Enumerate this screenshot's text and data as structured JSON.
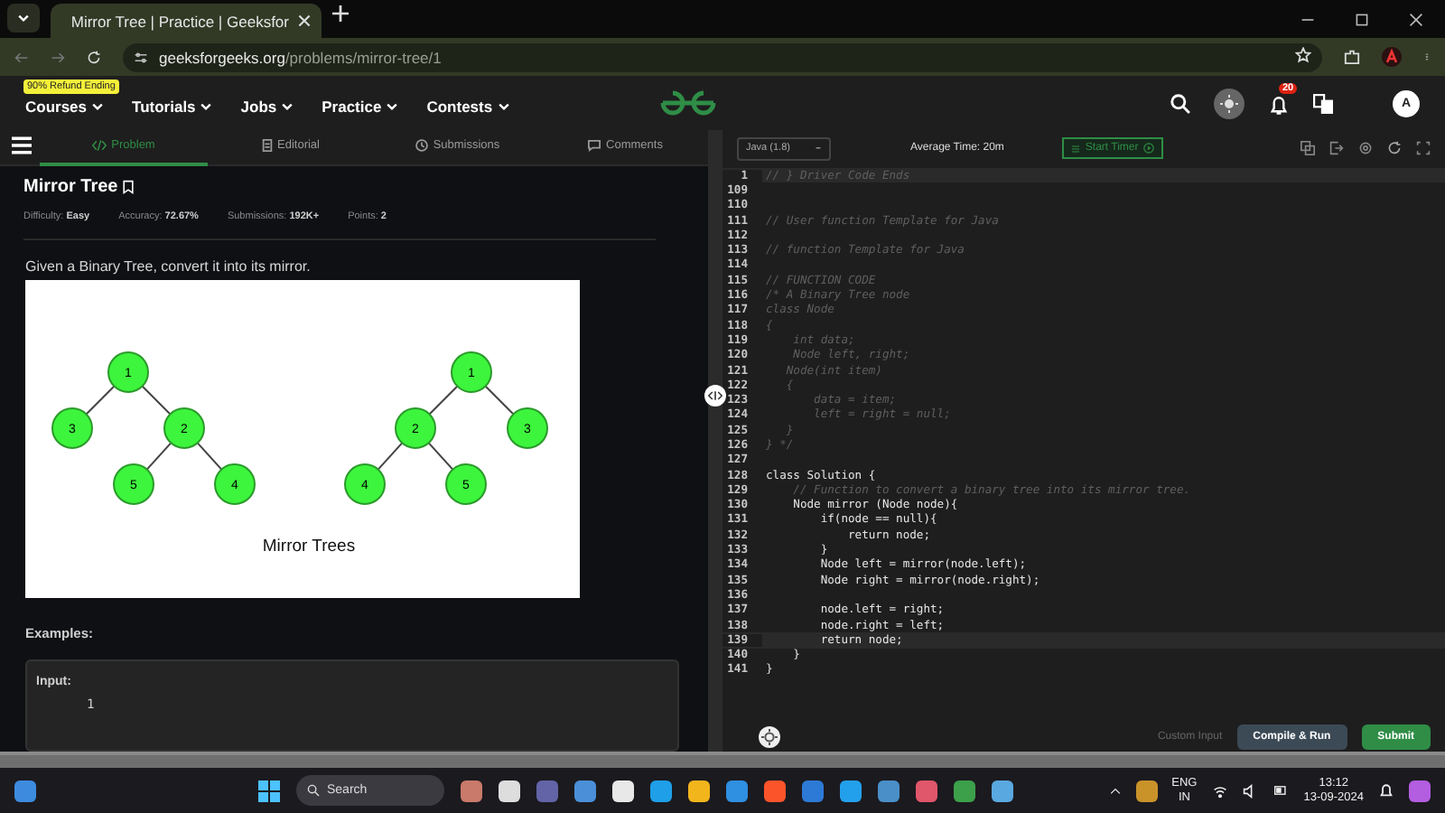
{
  "browser": {
    "tab_title": "Mirror Tree | Practice | Geeksfor",
    "url_domain": "geeksforgeeks.org",
    "url_path": "/problems/mirror-tree/1"
  },
  "site_nav": {
    "promo_badge": "90% Refund Ending",
    "items": [
      "Courses",
      "Tutorials",
      "Jobs",
      "Practice",
      "Contests"
    ],
    "notification_count": "20",
    "avatar_letter": "A"
  },
  "problem_tabs": [
    {
      "label": "Problem",
      "selected": true,
      "kind": "code"
    },
    {
      "label": "Editorial",
      "selected": false,
      "kind": "doc"
    },
    {
      "label": "Submissions",
      "selected": false,
      "kind": "clock"
    },
    {
      "label": "Comments",
      "selected": false,
      "kind": "chat"
    }
  ],
  "problem": {
    "title": "Mirror Tree",
    "meta": [
      "Difficulty: **Easy**",
      "Accuracy: **72.67%**",
      "Submissions: **192K+**",
      "Points: **2**"
    ],
    "description": "Given a Binary Tree, convert it into its mirror.",
    "figure": {
      "caption": "Mirror Trees",
      "trees": [
        {
          "label": "1",
          "children": [
            {
              "label": "3"
            },
            {
              "label": "2",
              "children": [
                {
                  "label": "5"
                },
                {
                  "label": "4"
                }
              ]
            }
          ]
        },
        {
          "label": "1",
          "children": [
            {
              "label": "2",
              "children": [
                {
                  "label": "4"
                },
                {
                  "label": "5"
                }
              ]
            },
            {
              "label": "3"
            }
          ]
        }
      ]
    },
    "examples_heading": "Examples:",
    "example_input_label": "Input:",
    "example_input_lines": [
      "1"
    ]
  },
  "editor": {
    "language": "Java (1.8)",
    "average_time": "Average Time: 20m",
    "timer_button": "Start Timer",
    "lines": [
      {
        "num": "1",
        "text": "// } Driver Code Ends",
        "kind": "comment",
        "highlighted": true
      },
      {
        "num": "109",
        "kind": "blank",
        "highlighted": false
      },
      {
        "num": "110",
        "kind": "blank",
        "highlighted": false
      },
      {
        "num": "111",
        "text": "// User function Template for Java",
        "kind": "comment",
        "highlighted": false
      },
      {
        "num": "112",
        "kind": "blank",
        "highlighted": false
      },
      {
        "num": "113",
        "text": "// function Template for Java",
        "kind": "comment",
        "highlighted": false
      },
      {
        "num": "114",
        "kind": "blank",
        "highlighted": false
      },
      {
        "num": "115",
        "text": "// FUNCTION CODE",
        "kind": "comment",
        "highlighted": false
      },
      {
        "num": "116",
        "text": "/* A Binary Tree node",
        "kind": "comment",
        "highlighted": false
      },
      {
        "num": "117",
        "text": "class Node",
        "kind": "comment",
        "highlighted": false
      },
      {
        "num": "118",
        "text": "{",
        "kind": "comment",
        "highlighted": false
      },
      {
        "num": "119",
        "text": "    int data;",
        "kind": "comment",
        "highlighted": false
      },
      {
        "num": "120",
        "text": "    Node left, right;",
        "kind": "comment",
        "highlighted": false
      },
      {
        "num": "121",
        "text": "   Node(int item)",
        "kind": "comment",
        "highlighted": false
      },
      {
        "num": "122",
        "text": "   {",
        "kind": "comment",
        "highlighted": false
      },
      {
        "num": "123",
        "text": "       data = item;",
        "kind": "comment",
        "highlighted": false
      },
      {
        "num": "124",
        "text": "       left = right = null;",
        "kind": "comment",
        "highlighted": false
      },
      {
        "num": "125",
        "text": "   }",
        "kind": "comment",
        "highlighted": false
      },
      {
        "num": "126",
        "text": "} */",
        "kind": "comment",
        "highlighted": false
      },
      {
        "num": "127",
        "kind": "blank",
        "highlighted": false
      },
      {
        "num": "128",
        "text": "class Solution {",
        "kind": "code",
        "highlighted": false
      },
      {
        "num": "129",
        "text": "    // Function to convert a binary tree into its mirror tree.",
        "kind": "comment",
        "highlighted": false
      },
      {
        "num": "130",
        "text": "    Node mirror (Node node){",
        "kind": "code",
        "highlighted": false
      },
      {
        "num": "131",
        "text": "        if(node == null){",
        "kind": "code",
        "highlighted": false
      },
      {
        "num": "132",
        "text": "            return node;",
        "kind": "code",
        "highlighted": false
      },
      {
        "num": "133",
        "text": "        }",
        "kind": "code",
        "highlighted": false
      },
      {
        "num": "134",
        "text": "        Node left = mirror(node.left);",
        "kind": "code",
        "highlighted": false
      },
      {
        "num": "135",
        "text": "        Node right = mirror(node.right);",
        "kind": "code",
        "highlighted": false
      },
      {
        "num": "136",
        "kind": "blank",
        "highlighted": false
      },
      {
        "num": "137",
        "text": "        node.left = right;",
        "kind": "code",
        "highlighted": false
      },
      {
        "num": "138",
        "text": "        node.right = left;",
        "kind": "code",
        "highlighted": false
      },
      {
        "num": "139",
        "text": "        return node;",
        "kind": "code",
        "highlighted": true
      },
      {
        "num": "140",
        "text": "    }",
        "kind": "code",
        "highlighted": false
      },
      {
        "num": "141",
        "text": "}",
        "kind": "code",
        "highlighted": false
      }
    ],
    "custom_input": "Custom Input",
    "compile_button": "Compile & Run",
    "submit_button": "Submit"
  },
  "taskbar": {
    "search": "Search",
    "lang_top": "ENG",
    "lang_bottom": "IN",
    "time": "13:12",
    "date": "13-09-2024"
  }
}
